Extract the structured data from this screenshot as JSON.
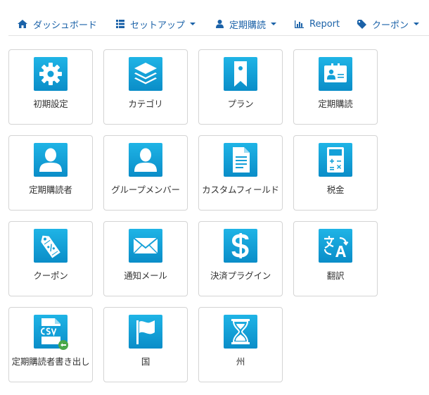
{
  "nav": {
    "dashboard": "ダッシュボード",
    "setup": "セットアップ",
    "subscription": "定期購読",
    "report": "Report",
    "coupon": "クーポン"
  },
  "tiles": [
    {
      "label": "初期設定",
      "icon": "gear-icon"
    },
    {
      "label": "カテゴリ",
      "icon": "layers-icon"
    },
    {
      "label": "プラン",
      "icon": "bookmark-icon"
    },
    {
      "label": "定期購読",
      "icon": "id-card-icon"
    },
    {
      "label": "定期購読者",
      "icon": "user-icon"
    },
    {
      "label": "グループメンバー",
      "icon": "user-icon"
    },
    {
      "label": "カスタムフィールド",
      "icon": "document-icon"
    },
    {
      "label": "税金",
      "icon": "calculator-icon"
    },
    {
      "label": "クーポン",
      "icon": "coupon-tag-icon"
    },
    {
      "label": "通知メール",
      "icon": "envelope-icon"
    },
    {
      "label": "決済プラグイン",
      "icon": "dollar-icon"
    },
    {
      "label": "翻訳",
      "icon": "translate-icon"
    },
    {
      "label": "定期購読者書き出し",
      "icon": "csv-export-icon"
    },
    {
      "label": "国",
      "icon": "flag-icon"
    },
    {
      "label": "州",
      "icon": "hourglass-icon"
    }
  ],
  "colors": {
    "accent": "#1b62a8",
    "tile_icon_top": "#1fb4e6",
    "tile_icon_bottom": "#0a8dc8",
    "badge": "#4aa84a"
  }
}
